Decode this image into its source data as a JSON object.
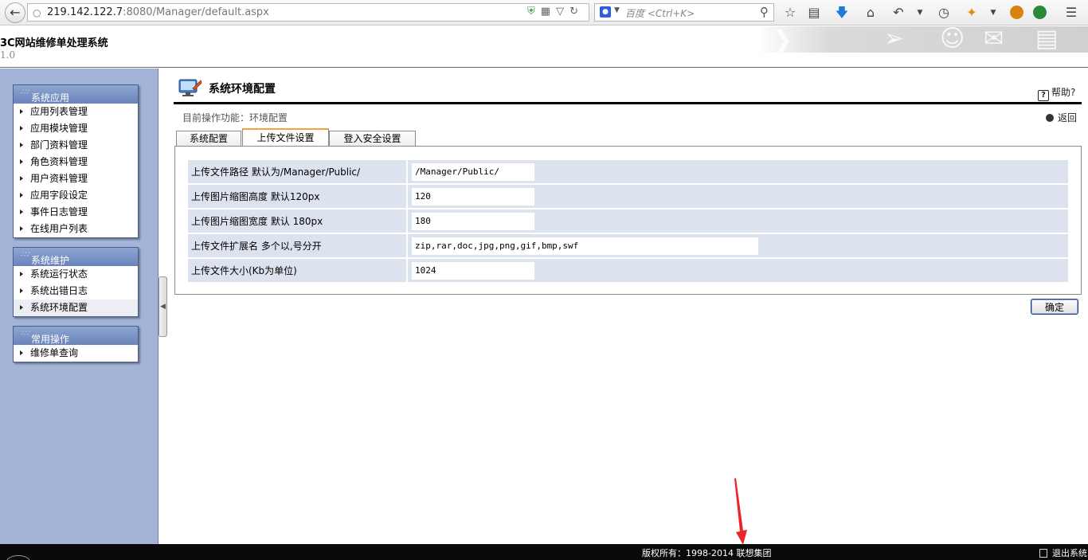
{
  "browser": {
    "url_host": "219.142.122.7",
    "url_rest": ":8080/Manager/default.aspx",
    "search_placeholder": "百度 <Ctrl+K>",
    "search_engine_icon": "baidu-paw-icon"
  },
  "app": {
    "title": "3C网站维修单处理系统",
    "version": "1.0"
  },
  "sidebar": {
    "panels": [
      {
        "title": "系统应用",
        "items": [
          "应用列表管理",
          "应用模块管理",
          "部门资料管理",
          "角色资料管理",
          "用户资料管理",
          "应用字段设定",
          "事件日志管理",
          "在线用户列表"
        ]
      },
      {
        "title": "系统维护",
        "items": [
          "系统运行状态",
          "系统出错日志",
          "系统环境配置"
        ]
      },
      {
        "title": "常用操作",
        "items": [
          "维修单查询"
        ]
      }
    ]
  },
  "page": {
    "title": "系统环境配置",
    "help": "帮助?",
    "crumb": "目前操作功能：环境配置",
    "back": "返回"
  },
  "tabs": [
    "系统配置",
    "上传文件设置",
    "登入安全设置"
  ],
  "active_tab": "上传文件设置",
  "form": {
    "rows": [
      {
        "label": "上传文件路径 默认为/Manager/Public/",
        "value": "/Manager/Public/"
      },
      {
        "label": "上传图片缩图高度 默认120px",
        "value": "120"
      },
      {
        "label": "上传图片缩图宽度 默认 180px",
        "value": "180"
      },
      {
        "label": "上传文件扩展名 多个以,号分开",
        "value": "zip,rar,doc,jpg,png,gif,bmp,swf"
      },
      {
        "label": "上传文件大小(Kb为单位)",
        "value": "1024"
      }
    ],
    "confirm": "确定"
  },
  "footer": {
    "copyright": "版权所有：1998-2014 联想集团",
    "logout": "退出系统"
  },
  "colors": {
    "sidebar_bg": "#a3b4d6",
    "panel_header": "#7890c4",
    "form_cell_bg": "#dce3ee",
    "tab_accent": "#f2a33a",
    "annotation_arrow": "#e8262b"
  }
}
